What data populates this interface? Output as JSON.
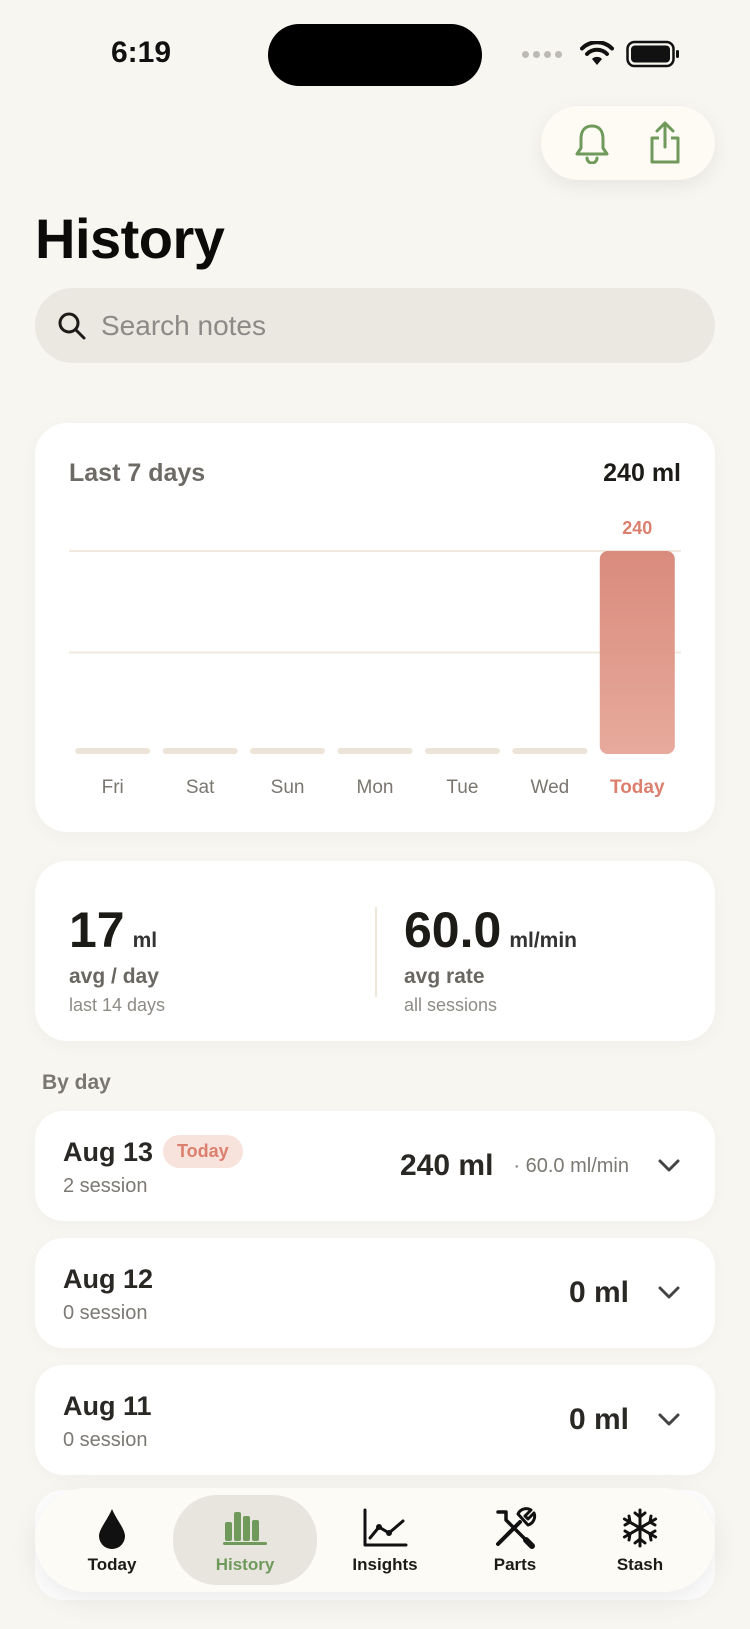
{
  "status": {
    "time": "6:19"
  },
  "header": {
    "title": "History"
  },
  "search": {
    "placeholder": "Search notes"
  },
  "colors": {
    "accent_green": "#6f9a5b",
    "bar_color": "#d98b7c",
    "today_label": "#db7f6e",
    "placeholder_bar": "#ece4d8"
  },
  "chart_data": {
    "type": "bar",
    "title": "Last 7 days",
    "total_label": "240 ml",
    "categories": [
      "Fri",
      "Sat",
      "Sun",
      "Mon",
      "Tue",
      "Wed",
      "Today"
    ],
    "values": [
      0,
      0,
      0,
      0,
      0,
      0,
      240
    ],
    "value_labels": [
      "",
      "",
      "",
      "",
      "",
      "",
      "240"
    ],
    "ylim": [
      0,
      240
    ],
    "grid": true,
    "highlight_category": "Today"
  },
  "stats": {
    "avg_day": {
      "value": "17",
      "unit": "ml",
      "label": "avg / day",
      "sub": "last 14 days"
    },
    "avg_rate": {
      "value": "60.0",
      "unit": "ml/min",
      "label": "avg rate",
      "sub": "all sessions"
    }
  },
  "by_day": {
    "label": "By day",
    "rows": [
      {
        "date": "Aug 13",
        "badge": "Today",
        "sessions": "2 session",
        "ml": "240 ml",
        "rate": "· 60.0 ml/min"
      },
      {
        "date": "Aug 12",
        "badge": "",
        "sessions": "0 session",
        "ml": "0 ml",
        "rate": ""
      },
      {
        "date": "Aug 11",
        "badge": "",
        "sessions": "0 session",
        "ml": "0 ml",
        "rate": ""
      }
    ]
  },
  "tabs": [
    {
      "label": "Today",
      "icon": "drop-icon"
    },
    {
      "label": "History",
      "icon": "bar-chart-icon",
      "active": true
    },
    {
      "label": "Insights",
      "icon": "line-chart-icon"
    },
    {
      "label": "Parts",
      "icon": "tools-icon"
    },
    {
      "label": "Stash",
      "icon": "snowflake-icon"
    }
  ]
}
